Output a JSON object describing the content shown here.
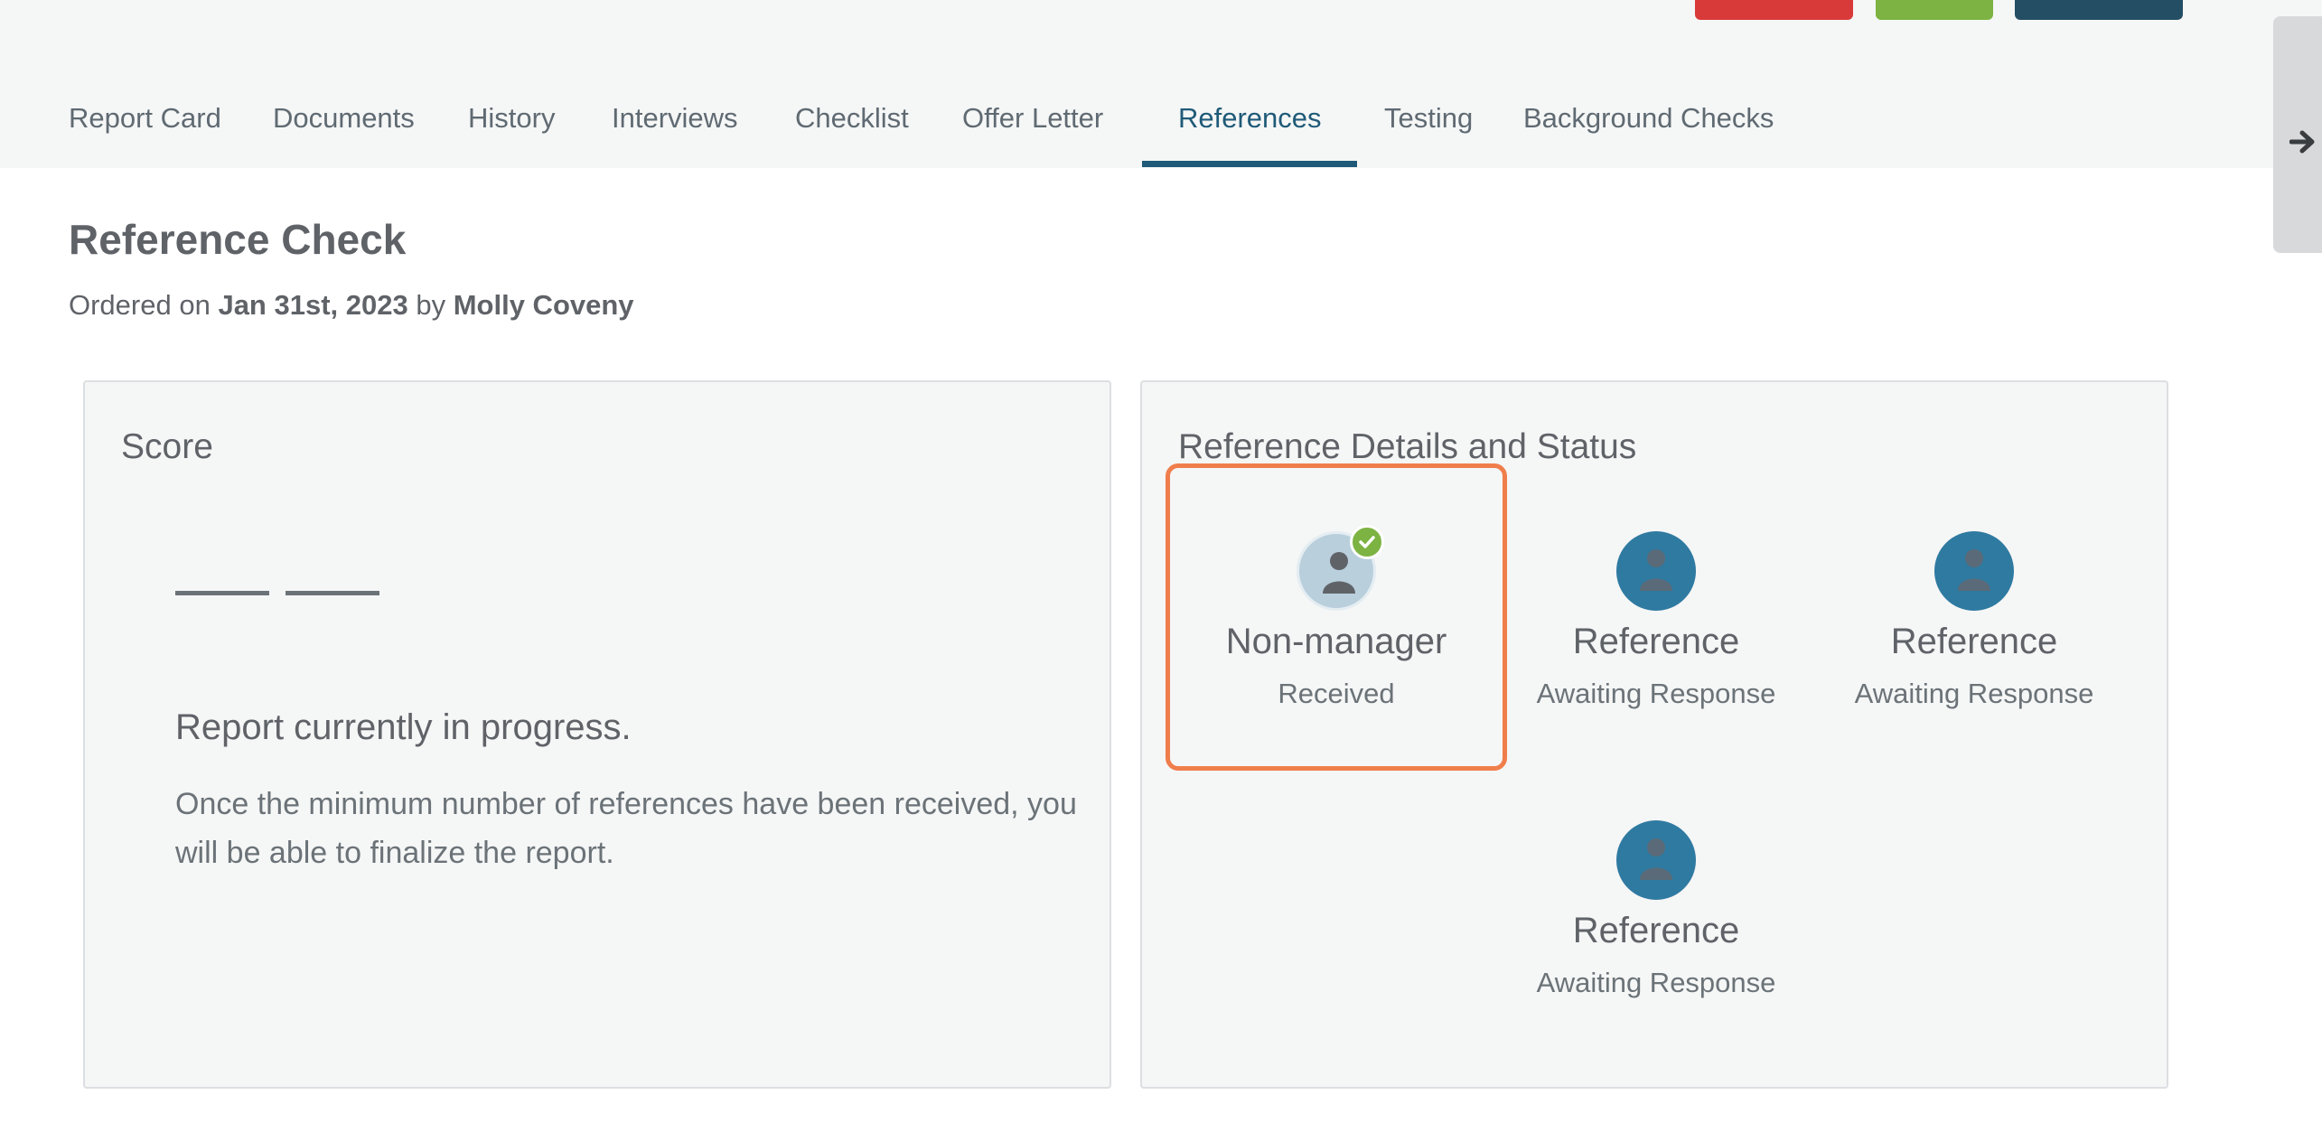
{
  "colors": {
    "accent": "#1f5a78",
    "button_red": "#d83a3a",
    "button_green": "#7cb342",
    "button_navy": "#244e63",
    "highlight": "#f07e4c",
    "received_badge": "#7cb342",
    "pending_avatar": "#2f7aa1"
  },
  "tabs": [
    {
      "label": "Report Card"
    },
    {
      "label": "Documents"
    },
    {
      "label": "History"
    },
    {
      "label": "Interviews"
    },
    {
      "label": "Checklist"
    },
    {
      "label": "Offer Letter"
    },
    {
      "label": "References",
      "active": true
    },
    {
      "label": "Testing"
    },
    {
      "label": "Background Checks"
    }
  ],
  "side_handle": {
    "icon": "arrow-right-icon"
  },
  "page": {
    "title": "Reference Check",
    "ordered_prefix": "Ordered on",
    "ordered_date": "Jan 31st, 2023",
    "ordered_by_word": "by",
    "ordered_by": "Molly Coveny"
  },
  "score_panel": {
    "title": "Score",
    "progress_title": "Report currently in progress.",
    "progress_text": "Once the minimum number of references have been received, you will be able to finalize the report."
  },
  "references_panel": {
    "title": "Reference Details and Status",
    "references": [
      {
        "name": "Non-manager",
        "status": "Received",
        "state": "received",
        "icon": "person-icon"
      },
      {
        "name": "Reference",
        "status": "Awaiting Response",
        "state": "pending",
        "icon": "person-icon"
      },
      {
        "name": "Reference",
        "status": "Awaiting Response",
        "state": "pending",
        "icon": "person-icon"
      },
      {
        "name": "Reference",
        "status": "Awaiting Response",
        "state": "pending",
        "icon": "person-icon"
      }
    ]
  }
}
